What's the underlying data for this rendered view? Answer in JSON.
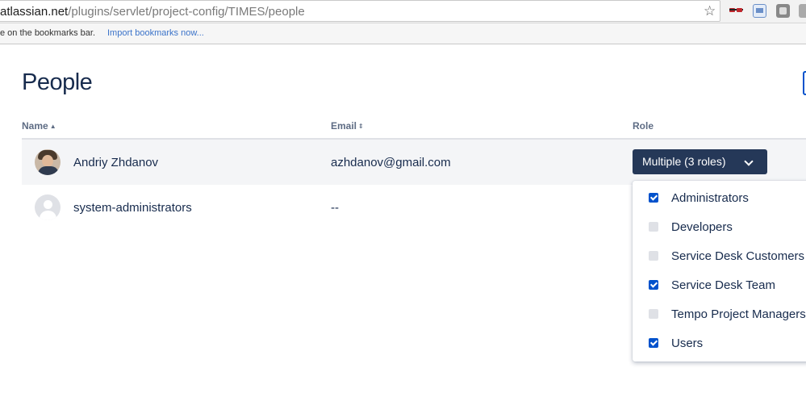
{
  "browser": {
    "url_host": "atlassian.net",
    "url_path": "/plugins/servlet/project-config/TIMES/people",
    "bookmarks_text": "e on the bookmarks bar.",
    "bookmarks_link": "Import bookmarks now..."
  },
  "page": {
    "title": "People",
    "columns": {
      "name": "Name",
      "email": "Email",
      "role": "Role"
    },
    "rows": [
      {
        "name": "Andriy Zhdanov",
        "email": "azhdanov@gmail.com",
        "role": "Multiple (3 roles)"
      },
      {
        "name": "system-administrators",
        "email": "--"
      }
    ]
  },
  "role_dropdown": {
    "options": [
      {
        "label": "Administrators",
        "checked": true
      },
      {
        "label": "Developers",
        "checked": false
      },
      {
        "label": "Service Desk Customers",
        "checked": false
      },
      {
        "label": "Service Desk Team",
        "checked": true
      },
      {
        "label": "Tempo Project Managers",
        "checked": false
      },
      {
        "label": "Users",
        "checked": true
      }
    ]
  },
  "colors": {
    "role_button_bg": "#253858",
    "checkbox_checked": "#0052cc",
    "checkbox_unchecked": "#dfe1e6",
    "heading": "#172b4d"
  }
}
